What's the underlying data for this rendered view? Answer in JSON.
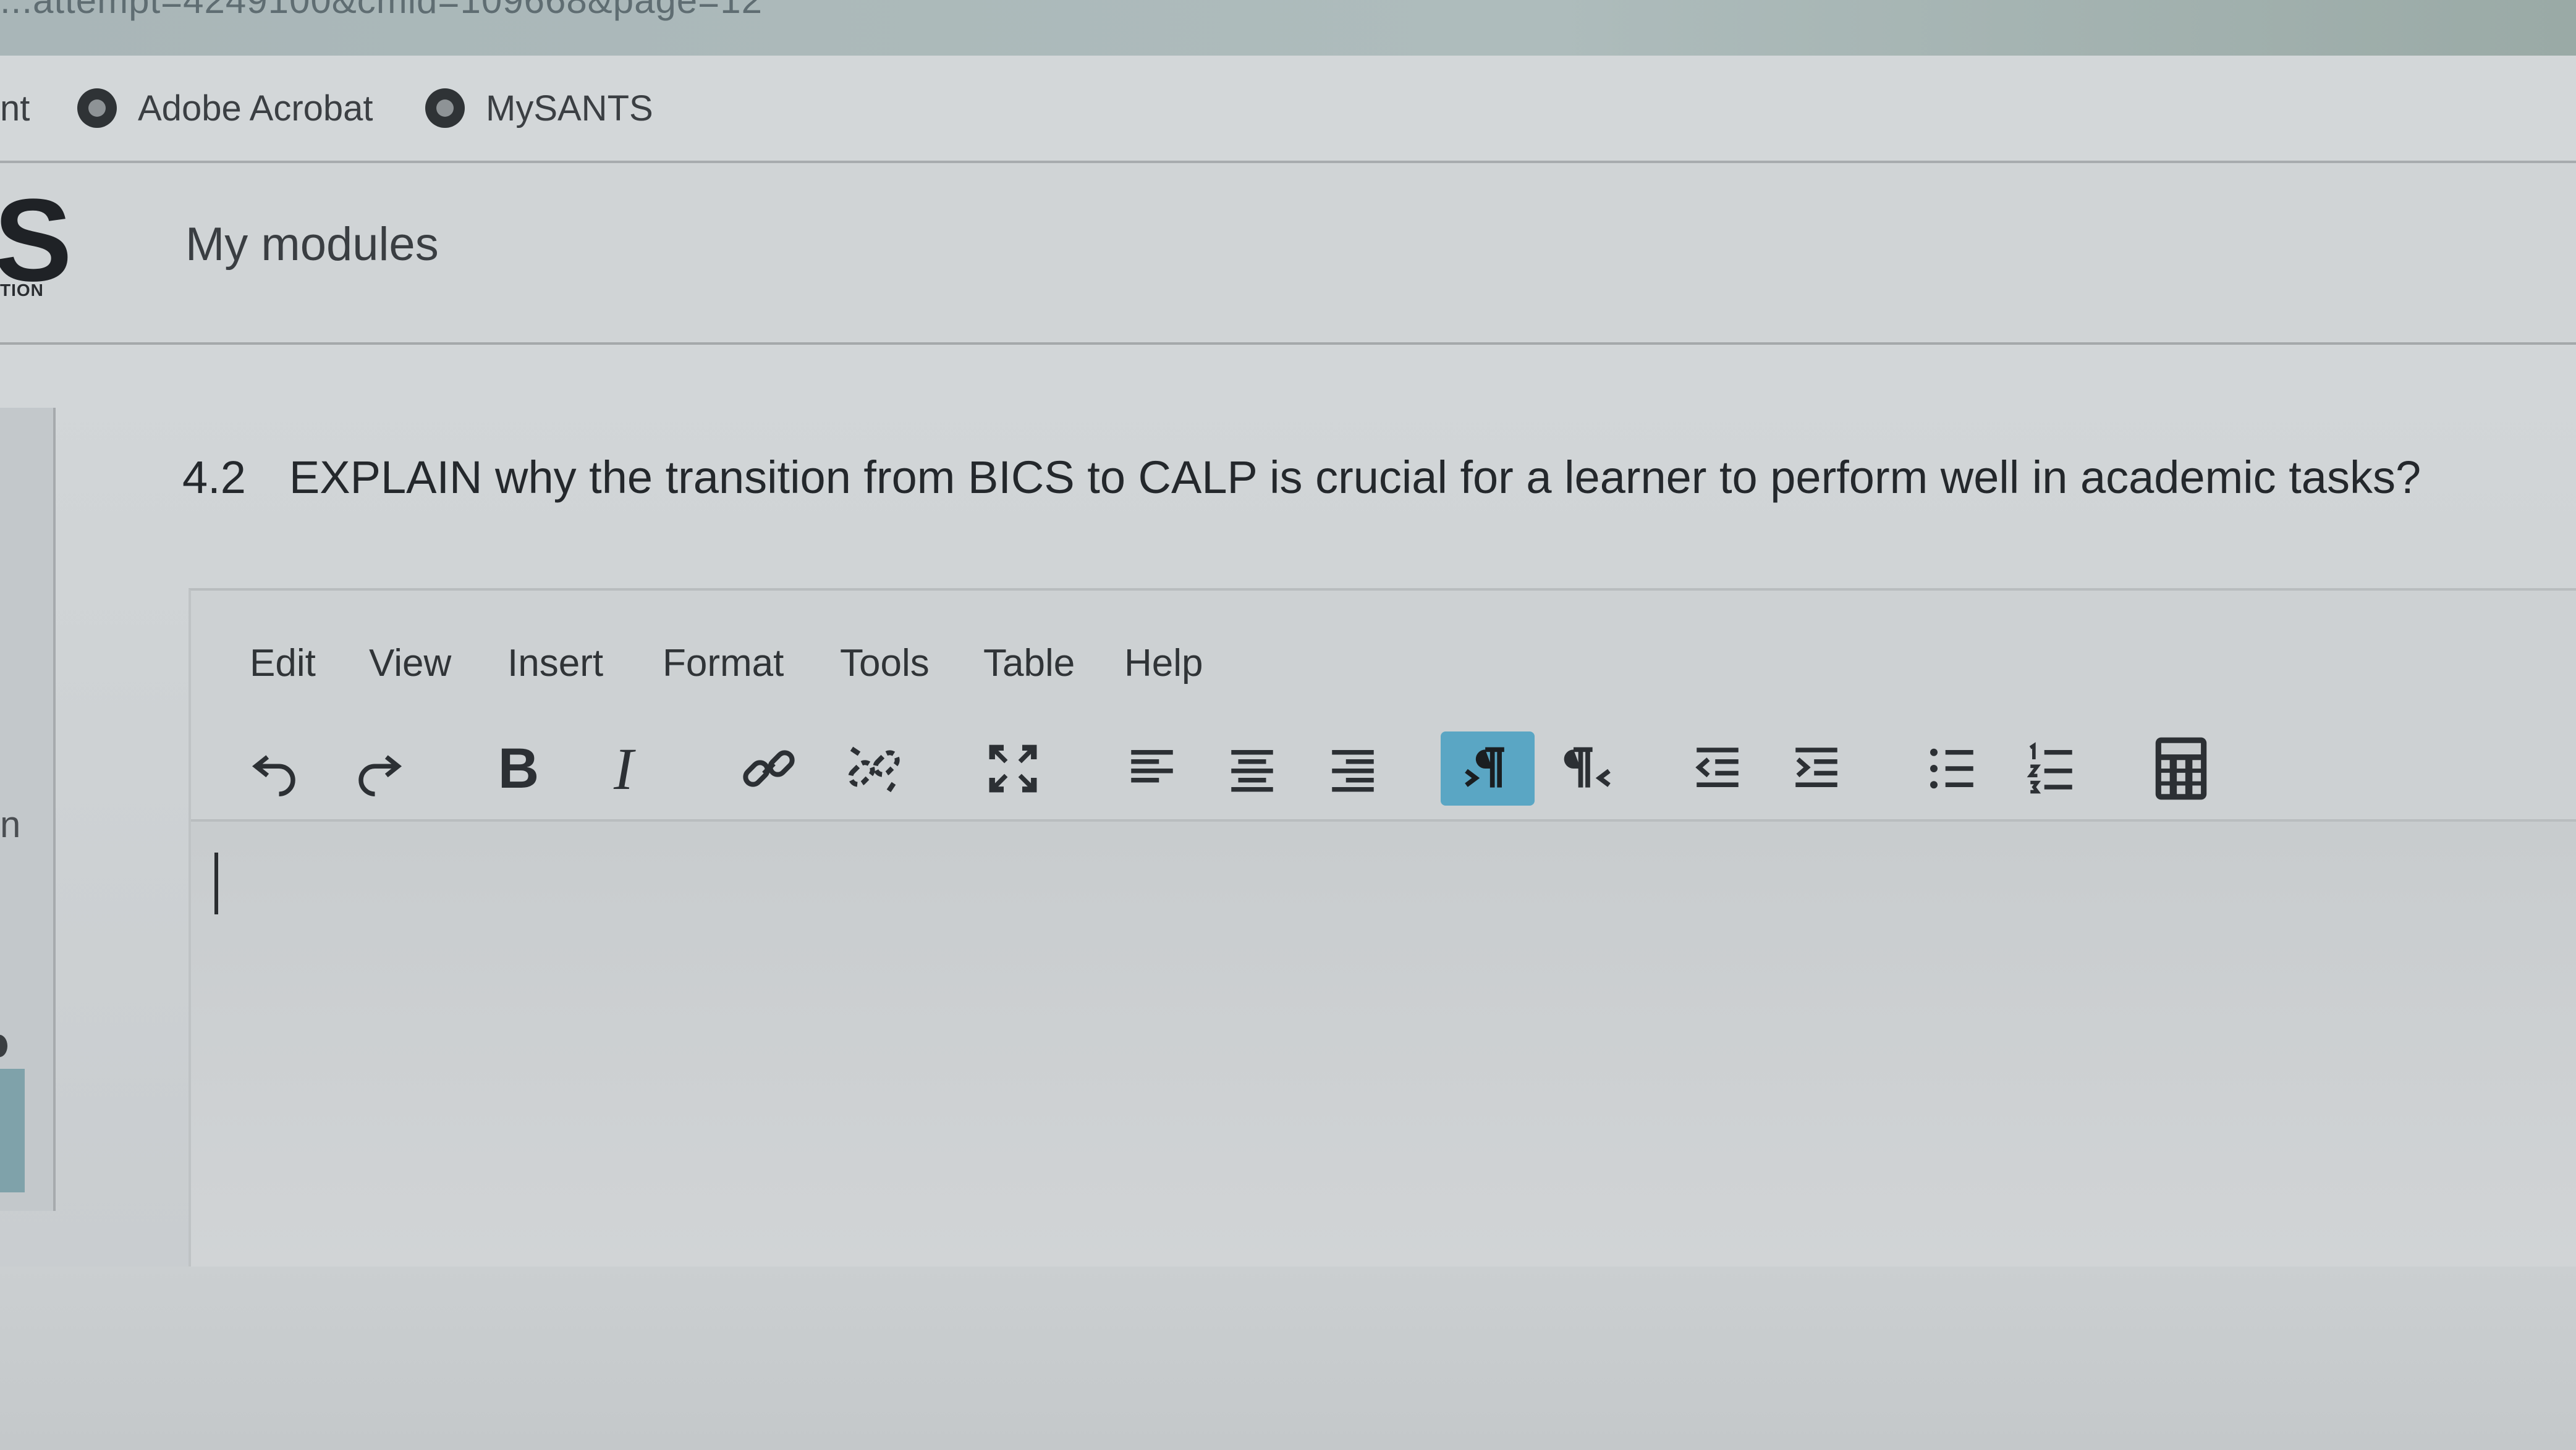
{
  "browser": {
    "url_fragment": "...attempt=4249100&cmid=109668&page=12"
  },
  "bookmarks": {
    "left_partial": "nt",
    "items": [
      {
        "label": "Adobe Acrobat",
        "icon": "adobe-acrobat-icon"
      },
      {
        "label": "MySANTS",
        "icon": "mysants-icon"
      }
    ]
  },
  "header": {
    "logo_letter": "S",
    "logo_sub": "TION",
    "nav_label": "My modules"
  },
  "sidebar": {
    "partial_letter": "n"
  },
  "question": {
    "number": "4.2",
    "text": "EXPLAIN why the transition from BICS to CALP is crucial for a learner to perform well in academic tasks?"
  },
  "editor": {
    "menu": [
      "Edit",
      "View",
      "Insert",
      "Format",
      "Tools",
      "Table",
      "Help"
    ],
    "toolbar": [
      {
        "icon": "undo-icon"
      },
      {
        "icon": "redo-icon"
      },
      {
        "icon": "bold-icon",
        "glyph": "B"
      },
      {
        "icon": "italic-icon",
        "glyph": "I"
      },
      {
        "icon": "link-icon"
      },
      {
        "icon": "unlink-icon"
      },
      {
        "icon": "fullscreen-icon"
      },
      {
        "icon": "align-left-icon"
      },
      {
        "icon": "align-center-icon"
      },
      {
        "icon": "align-right-icon"
      },
      {
        "icon": "ltr-icon",
        "active": true
      },
      {
        "icon": "rtl-icon"
      },
      {
        "icon": "outdent-icon"
      },
      {
        "icon": "indent-icon"
      },
      {
        "icon": "bullet-list-icon"
      },
      {
        "icon": "numbered-list-icon"
      },
      {
        "icon": "calculator-icon"
      }
    ],
    "content": ""
  },
  "colors": {
    "active_tool": "#5aa6c4",
    "background": "#cfd3d6",
    "text": "#2b2f33"
  }
}
